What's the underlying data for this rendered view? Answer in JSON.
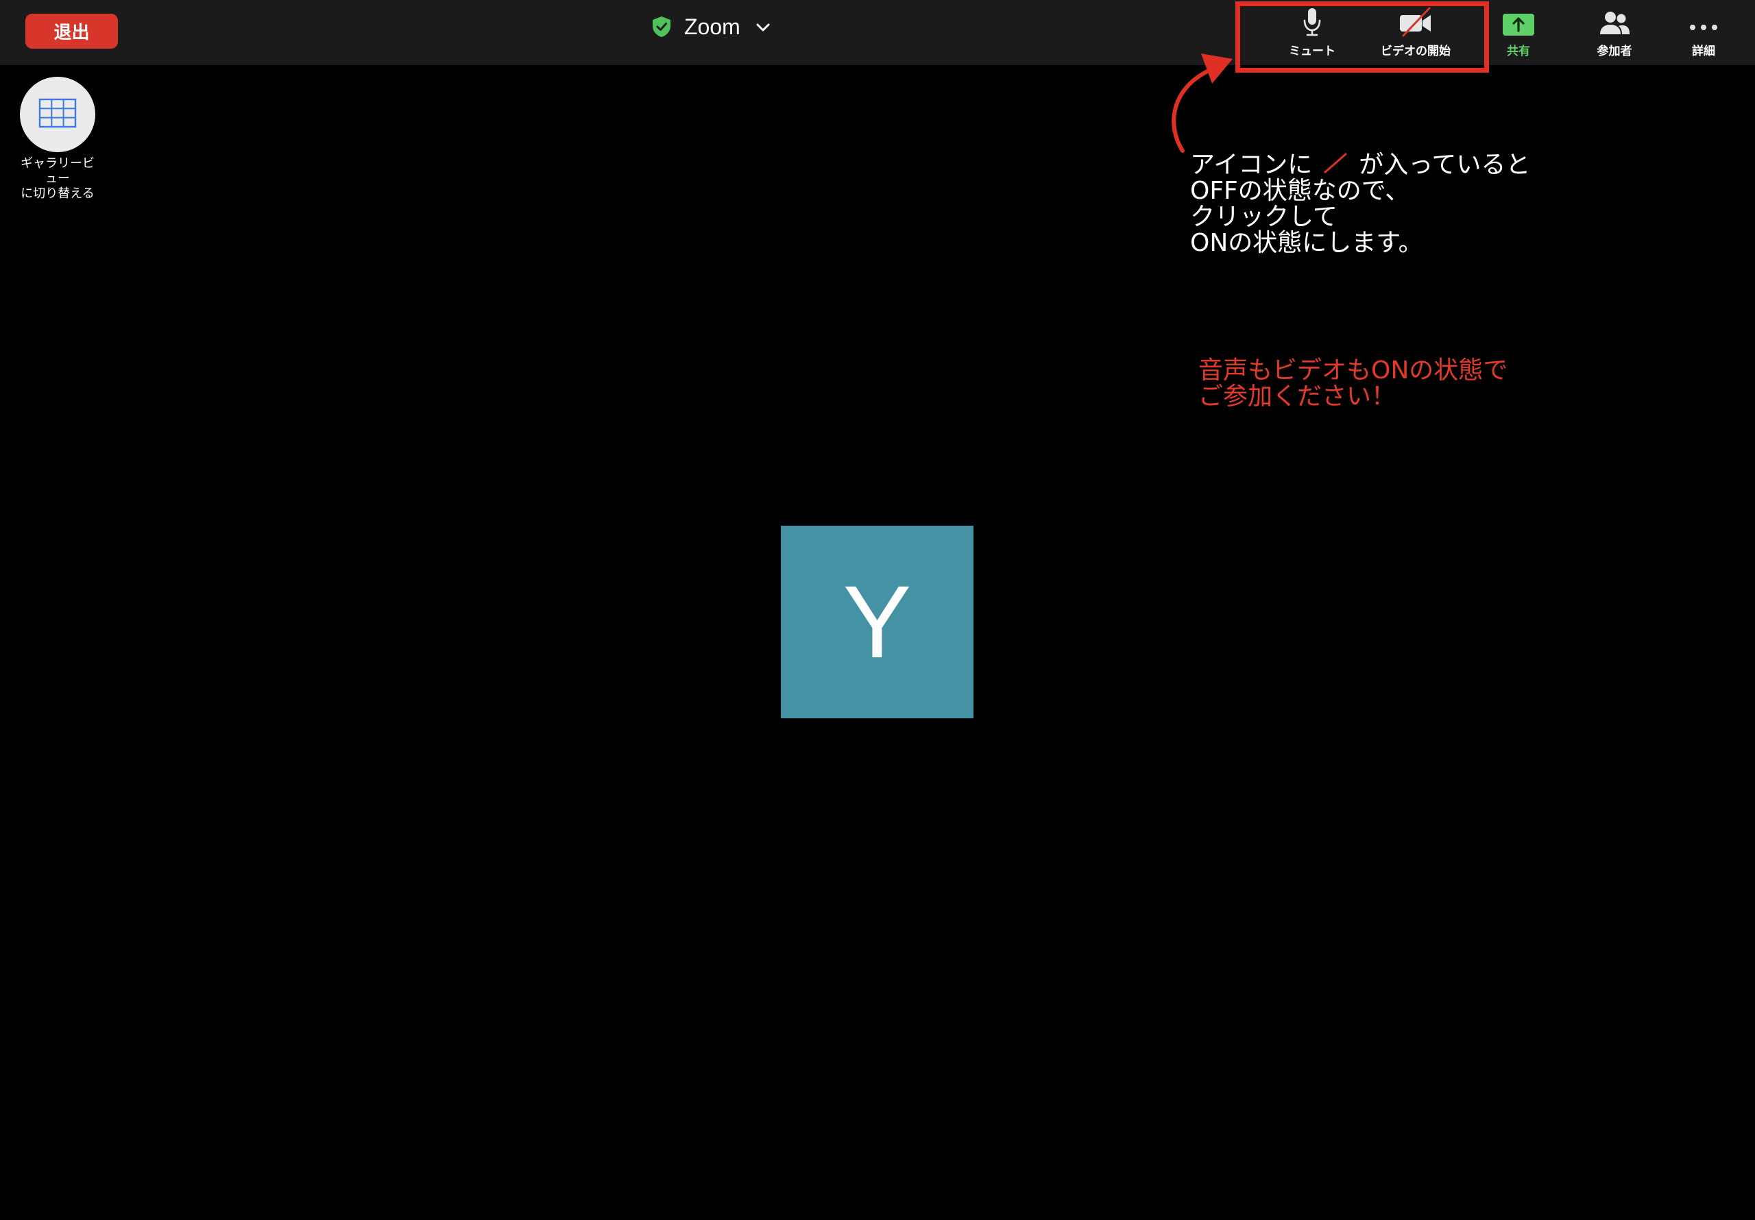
{
  "colors": {
    "topbar_bg": "#1b1b1b",
    "leave_button": "#d9362b",
    "share_green": "#5fd068",
    "highlight_red": "#e02f24",
    "avatar_bg": "#4592a5"
  },
  "topbar": {
    "leave_label": "退出",
    "title": "Zoom",
    "title_icon": "shield-check-icon",
    "dropdown_icon": "chevron-down-icon"
  },
  "toolbar": {
    "mute": {
      "label": "ミュート",
      "icon": "microphone-icon"
    },
    "video": {
      "label": "ビデオの開始",
      "icon": "video-off-icon"
    },
    "share": {
      "label": "共有",
      "icon": "share-screen-icon"
    },
    "participants": {
      "label": "参加者",
      "icon": "participants-icon"
    },
    "more": {
      "label": "詳細",
      "icon": "more-icon"
    }
  },
  "gallery": {
    "icon": "grid-icon",
    "label_line1": "ギャラリービ",
    "label_line2": "ュー",
    "label_line3": "に切り替える"
  },
  "annotation": {
    "line1_pre": "アイコンに",
    "line1_post": "が入っていると",
    "line2": "OFFの状態なので、",
    "line3": "クリックして",
    "line4": "ONの状態にします。",
    "red_line1": "音声もビデオもONの状態で",
    "red_line2": "ご参加ください！"
  },
  "participant": {
    "initial": "Y"
  }
}
